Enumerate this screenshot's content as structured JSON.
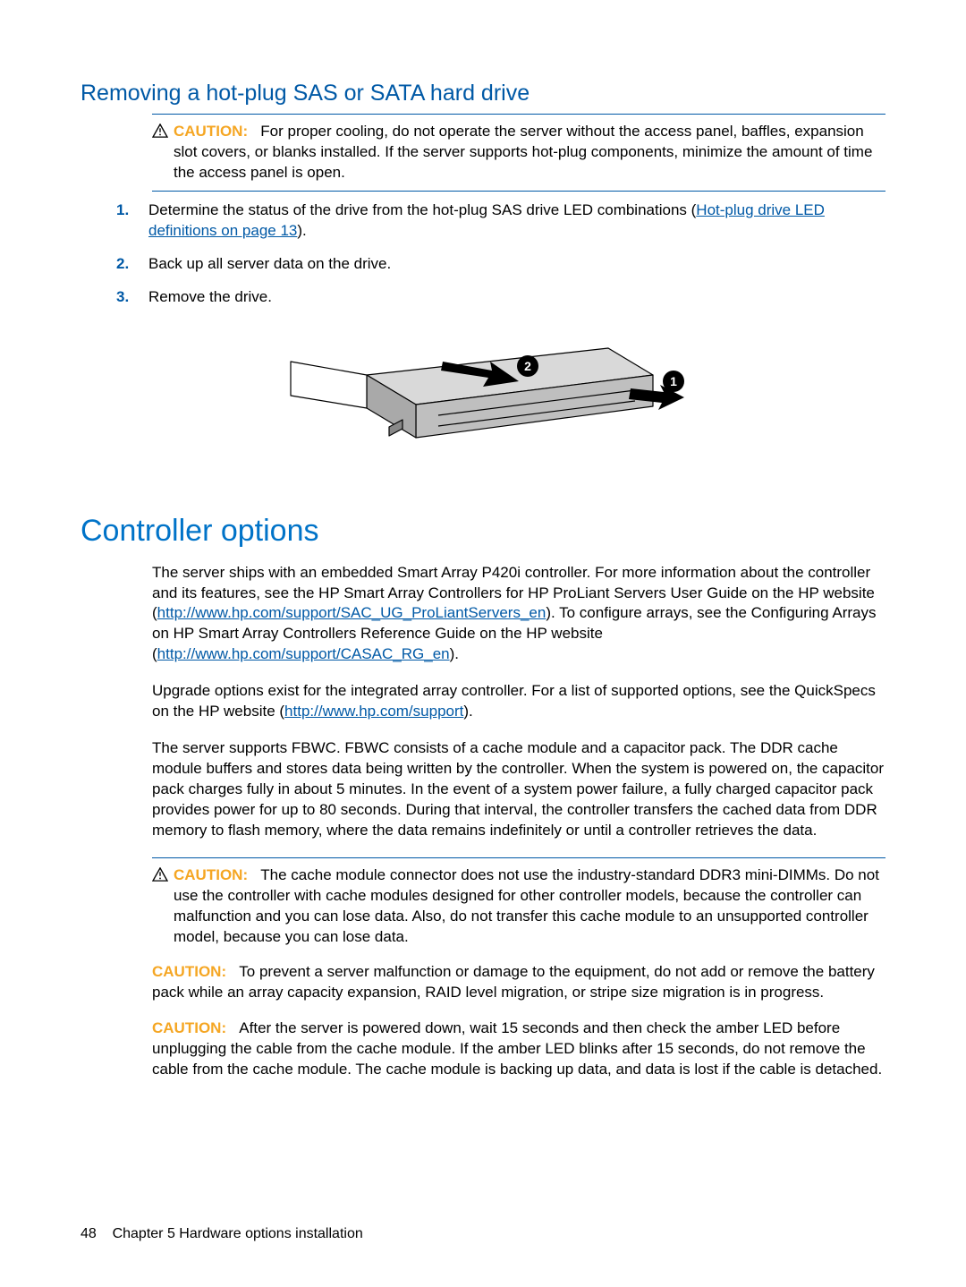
{
  "section1": {
    "heading": "Removing a hot-plug SAS or SATA hard drive",
    "caution_label": "CAUTION:",
    "caution_text": "For proper cooling, do not operate the server without the access panel, baffles, expansion slot covers, or blanks installed. If the server supports hot-plug components, minimize the amount of time the access panel is open.",
    "steps": [
      {
        "num": "1.",
        "text_before": "Determine the status of the drive from the hot-plug SAS drive LED combinations (",
        "link_text": "Hot-plug drive LED definitions on page 13",
        "text_after": ")."
      },
      {
        "num": "2.",
        "text": "Back up all server data on the drive."
      },
      {
        "num": "3.",
        "text": "Remove the drive."
      }
    ]
  },
  "section2": {
    "heading": "Controller options",
    "para1_a": "The server ships with an embedded Smart Array P420i controller. For more information about the controller and its features, see the HP Smart Array Controllers for HP ProLiant Servers User Guide on the HP website (",
    "para1_link1": "http://www.hp.com/support/SAC_UG_ProLiantServers_en",
    "para1_b": "). To configure arrays, see the Configuring Arrays on HP Smart Array Controllers Reference Guide on the HP website (",
    "para1_link2": "http://www.hp.com/support/CASAC_RG_en",
    "para1_c": ").",
    "para2_a": "Upgrade options exist for the integrated array controller. For a list of supported options, see the QuickSpecs on the HP website (",
    "para2_link": "http://www.hp.com/support",
    "para2_b": ").",
    "para3": "The server supports FBWC. FBWC consists of a cache module and a capacitor pack. The DDR cache module buffers and stores data being written by the controller. When the system is powered on, the capacitor pack charges fully in about 5 minutes. In the event of a system power failure, a fully charged capacitor pack provides power for up to 80 seconds. During that interval, the controller transfers the cached data from DDR memory to flash memory, where the data remains indefinitely or until a controller retrieves the data.",
    "caution1_label": "CAUTION:",
    "caution1_text": "The cache module connector does not use the industry-standard DDR3 mini-DIMMs. Do not use the controller with cache modules designed for other controller models, because the controller can malfunction and you can lose data. Also, do not transfer this cache module to an unsupported controller model, because you can lose data.",
    "caution2_label": "CAUTION:",
    "caution2_text": "To prevent a server malfunction or damage to the equipment, do not add or remove the battery pack while an array capacity expansion, RAID level migration, or stripe size migration is in progress.",
    "caution3_label": "CAUTION:",
    "caution3_text": "After the server is powered down, wait 15 seconds and then check the amber LED before unplugging the cable from the cache module. If the amber LED blinks after 15 seconds, do not remove the cable from the cache module. The cache module is backing up data, and data is lost if the cable is detached."
  },
  "footer": {
    "page_num": "48",
    "chapter": "Chapter 5   Hardware options installation"
  }
}
